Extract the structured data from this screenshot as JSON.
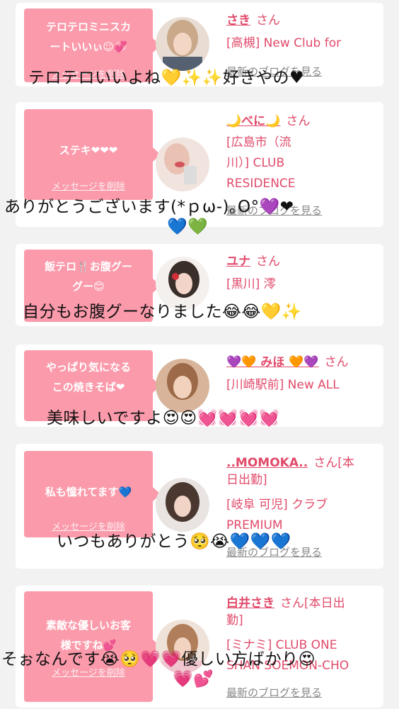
{
  "colors": {
    "page_bg": "#f2f2f2",
    "card_bg": "#ffffff",
    "bubble_pink": "#fb9aab",
    "name_pink": "#e14a6a",
    "link_gray": "#888888"
  },
  "delete_label": "メッセージを削除",
  "blog_label": "最新のブログを見る",
  "cards": [
    {
      "message": [
        "テロテロミニスカ",
        "ートいいぃ☺💞"
      ],
      "name": "さき",
      "honorific": "さん",
      "lines": [
        "[高槻] New Club for"
      ],
      "overlay": [
        "テロテロいいよね💛✨✨好きやの♥"
      ]
    },
    {
      "message": [
        "ステキ❤❤❤"
      ],
      "name": "🌙べに🌙",
      "honorific": "さん",
      "lines": [
        "[広島市（流",
        "川）] CLUB",
        "RESIDENCE"
      ],
      "overlay": [
        "ありがとうございます(*ｐω-)｡O°💜❤",
        "💙💚"
      ]
    },
    {
      "message": [
        "飯テロ🍴お腹グー",
        "グー😊"
      ],
      "name": "ユナ",
      "honorific": "さん",
      "lines": [
        "[黒川] 澪"
      ],
      "overlay": [
        "自分もお腹グーなりました😂😂💛✨"
      ]
    },
    {
      "message": [
        "やっぱり気になる",
        "この焼きそば❤"
      ],
      "name": "💜🧡 みほ 🧡💜",
      "honorific": "さん",
      "lines": [
        "[川崎駅前] New ALL"
      ],
      "overlay": [
        "美味しいですよ😍😍💓💓💓💓"
      ]
    },
    {
      "message": [
        "私も憧れてます💙"
      ],
      "name": "..MOMOKA..",
      "honorific": "さん[本",
      "lines": [
        "日出勤]",
        "[岐阜 可児] クラブ",
        "PREMIUM"
      ],
      "overlay": [
        "いつもありがとう🥺😭💙💙💙"
      ]
    },
    {
      "message": [
        "素敵な優しいお客",
        "様ですね💕"
      ],
      "name": "白井さき",
      "honorific": "さん[本日出",
      "lines": [
        "勤]",
        "[ミナミ] CLUB ONE",
        "SHAN SOEMON-CHO"
      ],
      "overlay": [
        "そぉなんです😭🥺💗💗優しい方ばかり😍",
        "💗💕"
      ]
    }
  ]
}
